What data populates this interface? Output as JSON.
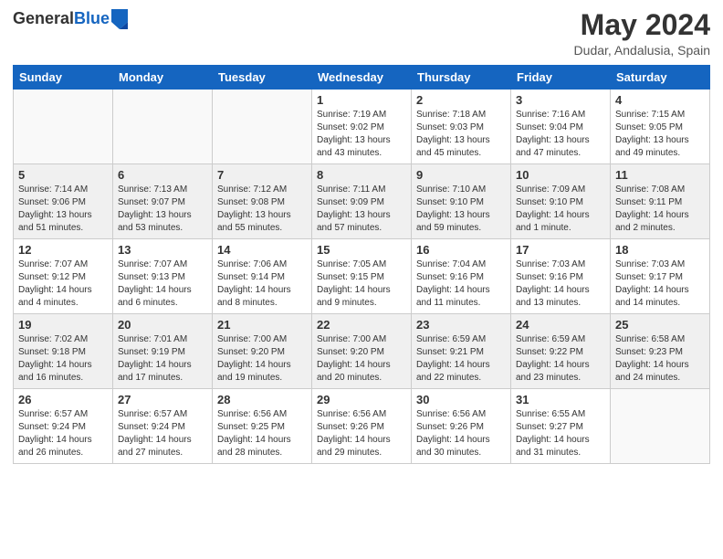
{
  "header": {
    "logo_general": "General",
    "logo_blue": "Blue",
    "month_title": "May 2024",
    "location": "Dudar, Andalusia, Spain"
  },
  "weekdays": [
    "Sunday",
    "Monday",
    "Tuesday",
    "Wednesday",
    "Thursday",
    "Friday",
    "Saturday"
  ],
  "weeks": [
    [
      {
        "day": "",
        "info": ""
      },
      {
        "day": "",
        "info": ""
      },
      {
        "day": "",
        "info": ""
      },
      {
        "day": "1",
        "info": "Sunrise: 7:19 AM\nSunset: 9:02 PM\nDaylight: 13 hours\nand 43 minutes."
      },
      {
        "day": "2",
        "info": "Sunrise: 7:18 AM\nSunset: 9:03 PM\nDaylight: 13 hours\nand 45 minutes."
      },
      {
        "day": "3",
        "info": "Sunrise: 7:16 AM\nSunset: 9:04 PM\nDaylight: 13 hours\nand 47 minutes."
      },
      {
        "day": "4",
        "info": "Sunrise: 7:15 AM\nSunset: 9:05 PM\nDaylight: 13 hours\nand 49 minutes."
      }
    ],
    [
      {
        "day": "5",
        "info": "Sunrise: 7:14 AM\nSunset: 9:06 PM\nDaylight: 13 hours\nand 51 minutes."
      },
      {
        "day": "6",
        "info": "Sunrise: 7:13 AM\nSunset: 9:07 PM\nDaylight: 13 hours\nand 53 minutes."
      },
      {
        "day": "7",
        "info": "Sunrise: 7:12 AM\nSunset: 9:08 PM\nDaylight: 13 hours\nand 55 minutes."
      },
      {
        "day": "8",
        "info": "Sunrise: 7:11 AM\nSunset: 9:09 PM\nDaylight: 13 hours\nand 57 minutes."
      },
      {
        "day": "9",
        "info": "Sunrise: 7:10 AM\nSunset: 9:10 PM\nDaylight: 13 hours\nand 59 minutes."
      },
      {
        "day": "10",
        "info": "Sunrise: 7:09 AM\nSunset: 9:10 PM\nDaylight: 14 hours\nand 1 minute."
      },
      {
        "day": "11",
        "info": "Sunrise: 7:08 AM\nSunset: 9:11 PM\nDaylight: 14 hours\nand 2 minutes."
      }
    ],
    [
      {
        "day": "12",
        "info": "Sunrise: 7:07 AM\nSunset: 9:12 PM\nDaylight: 14 hours\nand 4 minutes."
      },
      {
        "day": "13",
        "info": "Sunrise: 7:07 AM\nSunset: 9:13 PM\nDaylight: 14 hours\nand 6 minutes."
      },
      {
        "day": "14",
        "info": "Sunrise: 7:06 AM\nSunset: 9:14 PM\nDaylight: 14 hours\nand 8 minutes."
      },
      {
        "day": "15",
        "info": "Sunrise: 7:05 AM\nSunset: 9:15 PM\nDaylight: 14 hours\nand 9 minutes."
      },
      {
        "day": "16",
        "info": "Sunrise: 7:04 AM\nSunset: 9:16 PM\nDaylight: 14 hours\nand 11 minutes."
      },
      {
        "day": "17",
        "info": "Sunrise: 7:03 AM\nSunset: 9:16 PM\nDaylight: 14 hours\nand 13 minutes."
      },
      {
        "day": "18",
        "info": "Sunrise: 7:03 AM\nSunset: 9:17 PM\nDaylight: 14 hours\nand 14 minutes."
      }
    ],
    [
      {
        "day": "19",
        "info": "Sunrise: 7:02 AM\nSunset: 9:18 PM\nDaylight: 14 hours\nand 16 minutes."
      },
      {
        "day": "20",
        "info": "Sunrise: 7:01 AM\nSunset: 9:19 PM\nDaylight: 14 hours\nand 17 minutes."
      },
      {
        "day": "21",
        "info": "Sunrise: 7:00 AM\nSunset: 9:20 PM\nDaylight: 14 hours\nand 19 minutes."
      },
      {
        "day": "22",
        "info": "Sunrise: 7:00 AM\nSunset: 9:20 PM\nDaylight: 14 hours\nand 20 minutes."
      },
      {
        "day": "23",
        "info": "Sunrise: 6:59 AM\nSunset: 9:21 PM\nDaylight: 14 hours\nand 22 minutes."
      },
      {
        "day": "24",
        "info": "Sunrise: 6:59 AM\nSunset: 9:22 PM\nDaylight: 14 hours\nand 23 minutes."
      },
      {
        "day": "25",
        "info": "Sunrise: 6:58 AM\nSunset: 9:23 PM\nDaylight: 14 hours\nand 24 minutes."
      }
    ],
    [
      {
        "day": "26",
        "info": "Sunrise: 6:57 AM\nSunset: 9:24 PM\nDaylight: 14 hours\nand 26 minutes."
      },
      {
        "day": "27",
        "info": "Sunrise: 6:57 AM\nSunset: 9:24 PM\nDaylight: 14 hours\nand 27 minutes."
      },
      {
        "day": "28",
        "info": "Sunrise: 6:56 AM\nSunset: 9:25 PM\nDaylight: 14 hours\nand 28 minutes."
      },
      {
        "day": "29",
        "info": "Sunrise: 6:56 AM\nSunset: 9:26 PM\nDaylight: 14 hours\nand 29 minutes."
      },
      {
        "day": "30",
        "info": "Sunrise: 6:56 AM\nSunset: 9:26 PM\nDaylight: 14 hours\nand 30 minutes."
      },
      {
        "day": "31",
        "info": "Sunrise: 6:55 AM\nSunset: 9:27 PM\nDaylight: 14 hours\nand 31 minutes."
      },
      {
        "day": "",
        "info": ""
      }
    ]
  ]
}
